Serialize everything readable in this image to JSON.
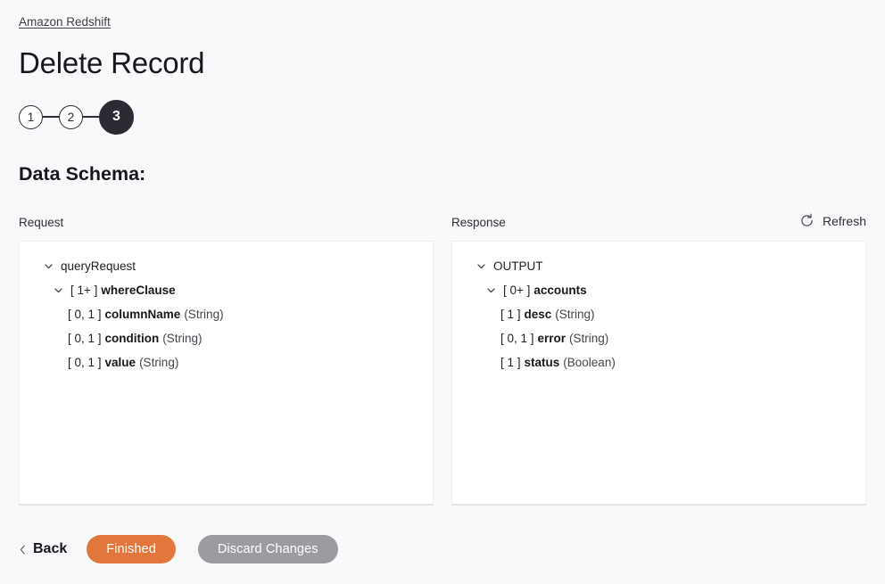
{
  "breadcrumb": {
    "label": "Amazon Redshift"
  },
  "header": {
    "title": "Delete Record"
  },
  "stepper": {
    "steps": [
      {
        "label": "1",
        "state": "inactive"
      },
      {
        "label": "2",
        "state": "inactive"
      },
      {
        "label": "3",
        "state": "active"
      }
    ]
  },
  "section": {
    "heading": "Data Schema:"
  },
  "schema": {
    "request_label": "Request",
    "response_label": "Response",
    "refresh_label": "Refresh",
    "refresh_icon": "refresh-icon",
    "request_tree": [
      {
        "level": 0,
        "caret": "chevron-down-icon",
        "multiplicity": "",
        "name": "queryRequest",
        "type": "",
        "bold": false
      },
      {
        "level": 1,
        "caret": "chevron-down-icon",
        "multiplicity": "[ 1+ ]",
        "name": "whereClause",
        "type": "",
        "bold": true
      },
      {
        "level": 2,
        "caret": "",
        "multiplicity": "[ 0, 1 ]",
        "name": "columnName",
        "type": "(String)",
        "bold": true
      },
      {
        "level": 2,
        "caret": "",
        "multiplicity": "[ 0, 1 ]",
        "name": "condition",
        "type": "(String)",
        "bold": true
      },
      {
        "level": 2,
        "caret": "",
        "multiplicity": "[ 0, 1 ]",
        "name": "value",
        "type": "(String)",
        "bold": true
      }
    ],
    "response_tree": [
      {
        "level": 0,
        "caret": "chevron-down-icon",
        "multiplicity": "",
        "name": "OUTPUT",
        "type": "",
        "bold": false
      },
      {
        "level": 1,
        "caret": "chevron-down-icon",
        "multiplicity": "[ 0+ ]",
        "name": "accounts",
        "type": "",
        "bold": true
      },
      {
        "level": 2,
        "caret": "",
        "multiplicity": "[ 1 ]",
        "name": "desc",
        "type": "(String)",
        "bold": true
      },
      {
        "level": 2,
        "caret": "",
        "multiplicity": "[ 0, 1 ]",
        "name": "error",
        "type": "(String)",
        "bold": true
      },
      {
        "level": 2,
        "caret": "",
        "multiplicity": "[ 1 ]",
        "name": "status",
        "type": "(Boolean)",
        "bold": true
      }
    ]
  },
  "footer": {
    "back_label": "Back",
    "back_icon": "chevron-left-icon",
    "finished_label": "Finished",
    "discard_label": "Discard Changes"
  },
  "colors": {
    "page_background": "#F8F9FA",
    "panel_background": "#FFFFFF",
    "accent_orange": "#E3763C",
    "neutral_grey": "#9B9BA1",
    "step_active": "#2B2B33",
    "text_primary": "#17181C"
  }
}
